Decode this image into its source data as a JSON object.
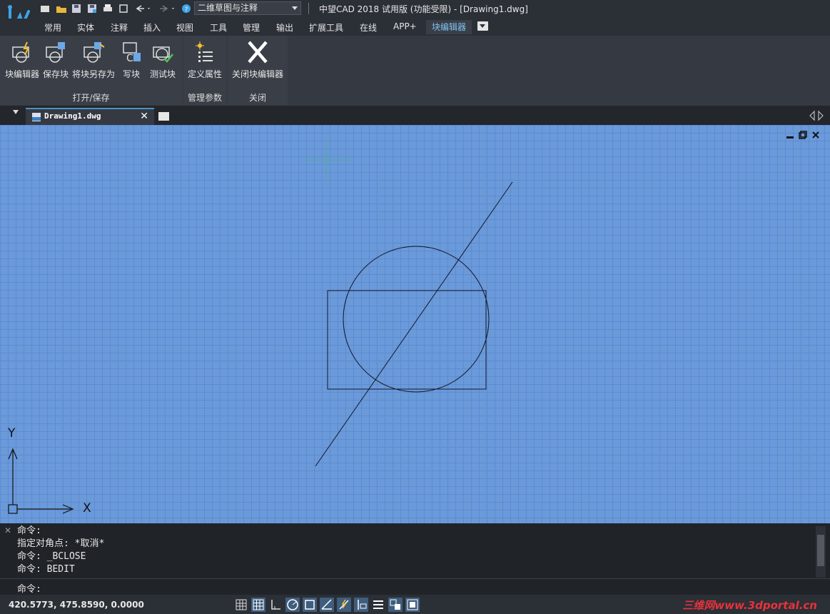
{
  "titlebar": {
    "workspace": "二维草图与注释",
    "window_title": "中望CAD 2018 试用版 (功能受限) - [Drawing1.dwg]"
  },
  "menu": {
    "tabs": [
      "常用",
      "实体",
      "注释",
      "插入",
      "视图",
      "工具",
      "管理",
      "输出",
      "扩展工具",
      "在线",
      "APP+",
      "块编辑器"
    ],
    "active": "块编辑器"
  },
  "ribbon": {
    "panels": [
      {
        "title": "打开/保存",
        "buttons": [
          "块编辑器",
          "保存块",
          "将块另存为",
          "写块",
          "测试块"
        ]
      },
      {
        "title": "管理参数",
        "buttons": [
          "定义属性"
        ]
      },
      {
        "title": "关闭",
        "buttons": [
          "关闭块编辑器"
        ]
      }
    ]
  },
  "document": {
    "tab_name": "Drawing1.dwg",
    "close_glyph": "✕"
  },
  "ucs": {
    "x_label": "X",
    "y_label": "Y"
  },
  "command": {
    "history": [
      "命令:",
      "指定对角点: *取消*",
      "命令: _BCLOSE",
      "命令: BEDIT"
    ],
    "prompt": "命令:",
    "input_value": ""
  },
  "status": {
    "coords": "420.5773, 475.8590, 0.0000",
    "watermark": "三维网www.3dportal.cn"
  },
  "colors": {
    "background": "#2b2f36",
    "canvas": "#6a9ad8",
    "accent": "#7ec3f5",
    "watermark": "#e8323a"
  }
}
